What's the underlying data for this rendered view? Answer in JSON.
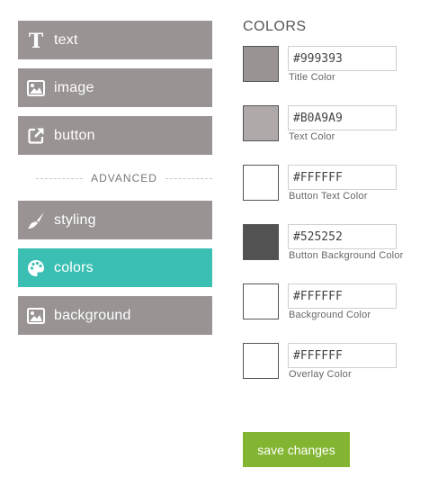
{
  "sidebar": {
    "items": [
      {
        "label": "text",
        "icon": "text-icon",
        "active": false
      },
      {
        "label": "image",
        "icon": "image-icon",
        "active": false
      },
      {
        "label": "button",
        "icon": "external-link-icon",
        "active": false
      },
      {
        "label": "styling",
        "icon": "paintbrush-icon",
        "active": false
      },
      {
        "label": "colors",
        "icon": "palette-icon",
        "active": true
      },
      {
        "label": "background",
        "icon": "image-icon",
        "active": false
      }
    ],
    "separator_label": "ADVANCED"
  },
  "colors_panel": {
    "title": "COLORS",
    "fields": [
      {
        "label": "Title Color",
        "value": "#999393",
        "swatch": "#999393"
      },
      {
        "label": "Text Color",
        "value": "#B0A9A9",
        "swatch": "#B0A9A9"
      },
      {
        "label": "Button Text Color",
        "value": "#FFFFFF",
        "swatch": "#FFFFFF"
      },
      {
        "label": "Button Background Color",
        "value": "#525252",
        "swatch": "#525252"
      },
      {
        "label": "Background Color",
        "value": "#FFFFFF",
        "swatch": "#FFFFFF"
      },
      {
        "label": "Overlay Color",
        "value": "#FFFFFF",
        "swatch": "#FFFFFF"
      }
    ],
    "save_label": "save changes"
  },
  "theme": {
    "nav_bg": "#999393",
    "nav_active_bg": "#3bbfb3",
    "save_bg": "#84b532"
  }
}
